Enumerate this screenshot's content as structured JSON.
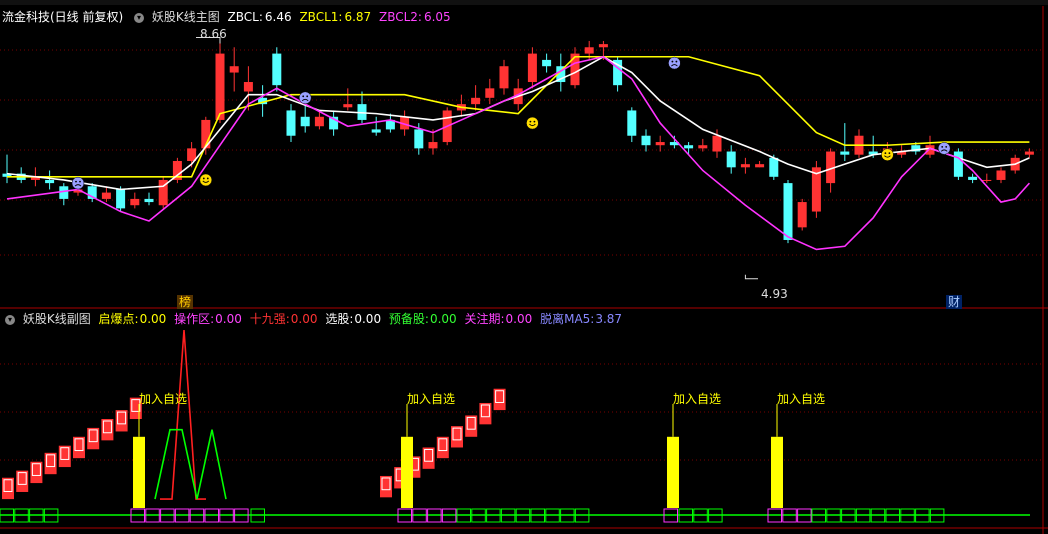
{
  "main_header": {
    "stock": "流金科技(日线 前复权)",
    "indicator": "妖股K线主图",
    "zbcl_label": "ZBCL:",
    "zbcl_value": "6.46",
    "zbcl1_label": "ZBCL1:",
    "zbcl1_value": "6.87",
    "zbcl2_label": "ZBCL2:",
    "zbcl2_value": "6.05",
    "high_label": "8.66",
    "low_label": "4.93",
    "badge_left": "榜",
    "badge_right": "财"
  },
  "sub_header": {
    "indicator": "妖股K线副图",
    "items": [
      {
        "label": "启爆点:",
        "value": "0.00",
        "color": "#ffff00"
      },
      {
        "label": "操作区:",
        "value": "0.00",
        "color": "#ff44ff"
      },
      {
        "label": "十九强:",
        "value": "0.00",
        "color": "#ff3333"
      },
      {
        "label": "选股:",
        "value": "0.00",
        "color": "#ffffff"
      },
      {
        "label": "预备股:",
        "value": "0.00",
        "color": "#33ff33"
      },
      {
        "label": "关注期:",
        "value": "0.00",
        "color": "#ff44ff"
      },
      {
        "label": "脱离MA5:",
        "value": "3.87",
        "color": "#8888ff"
      }
    ],
    "signal_text": "加入自选"
  },
  "colors": {
    "up": "#ff3333",
    "down": "#54ffff",
    "ma_white": "#ffffff",
    "ma_yellow": "#ffff00",
    "ma_magenta": "#ff33ff",
    "grid": "#7a0000",
    "green": "#00ff00",
    "yellow_bar": "#ffff00"
  },
  "chart_data": {
    "type": "candlestick",
    "ylim": [
      4.6,
      9.0
    ],
    "candles": [
      [
        6.6,
        6.55,
        6.9,
        6.45
      ],
      [
        6.6,
        6.5,
        6.7,
        6.45
      ],
      [
        6.5,
        6.55,
        6.7,
        6.4
      ],
      [
        6.5,
        6.45,
        6.65,
        6.35
      ],
      [
        6.4,
        6.2,
        6.45,
        6.1
      ],
      [
        6.3,
        6.35,
        6.45,
        6.25
      ],
      [
        6.4,
        6.2,
        6.45,
        6.15
      ],
      [
        6.2,
        6.3,
        6.4,
        6.15
      ],
      [
        6.35,
        6.05,
        6.4,
        6.0
      ],
      [
        6.1,
        6.2,
        6.3,
        6.05
      ],
      [
        6.2,
        6.15,
        6.3,
        6.1
      ],
      [
        6.1,
        6.5,
        6.55,
        6.05
      ],
      [
        6.5,
        6.8,
        6.85,
        6.45
      ],
      [
        6.8,
        7.0,
        7.1,
        6.7
      ],
      [
        7.0,
        7.45,
        7.5,
        6.9
      ],
      [
        7.45,
        8.5,
        8.66,
        7.4
      ],
      [
        8.2,
        8.3,
        8.6,
        7.9
      ],
      [
        7.9,
        8.05,
        8.3,
        7.6
      ],
      [
        7.8,
        7.7,
        8.0,
        7.5
      ],
      [
        8.5,
        8.0,
        8.6,
        7.9
      ],
      [
        7.6,
        7.2,
        7.7,
        7.1
      ],
      [
        7.5,
        7.35,
        7.7,
        7.25
      ],
      [
        7.35,
        7.5,
        7.6,
        7.3
      ],
      [
        7.5,
        7.3,
        7.6,
        7.2
      ],
      [
        7.65,
        7.7,
        7.95,
        7.6
      ],
      [
        7.7,
        7.45,
        7.9,
        7.4
      ],
      [
        7.3,
        7.25,
        7.5,
        7.2
      ],
      [
        7.45,
        7.3,
        7.55,
        7.25
      ],
      [
        7.3,
        7.5,
        7.6,
        7.2
      ],
      [
        7.3,
        7.0,
        7.4,
        6.9
      ],
      [
        7.0,
        7.1,
        7.3,
        6.9
      ],
      [
        7.1,
        7.6,
        7.65,
        7.05
      ],
      [
        7.6,
        7.7,
        7.85,
        7.5
      ],
      [
        7.7,
        7.8,
        8.0,
        7.6
      ],
      [
        7.8,
        7.95,
        8.1,
        7.7
      ],
      [
        7.95,
        8.3,
        8.4,
        7.85
      ],
      [
        7.7,
        7.95,
        8.1,
        7.6
      ],
      [
        8.05,
        8.5,
        8.6,
        7.95
      ],
      [
        8.4,
        8.3,
        8.5,
        8.2
      ],
      [
        8.3,
        8.05,
        8.5,
        7.9
      ],
      [
        8.0,
        8.5,
        8.6,
        7.95
      ],
      [
        8.5,
        8.6,
        8.7,
        8.4
      ],
      [
        8.6,
        8.65,
        8.7,
        8.4
      ],
      [
        8.4,
        8.0,
        8.45,
        7.9
      ],
      [
        7.6,
        7.2,
        7.65,
        7.1
      ],
      [
        7.2,
        7.05,
        7.3,
        6.95
      ],
      [
        7.05,
        7.1,
        7.2,
        6.95
      ],
      [
        7.1,
        7.05,
        7.2,
        7.0
      ],
      [
        7.05,
        7.0,
        7.1,
        6.9
      ],
      [
        7.0,
        7.05,
        7.15,
        6.95
      ],
      [
        6.95,
        7.2,
        7.3,
        6.85
      ],
      [
        6.95,
        6.7,
        7.05,
        6.6
      ],
      [
        6.7,
        6.75,
        6.85,
        6.6
      ],
      [
        6.7,
        6.75,
        6.8,
        6.7
      ],
      [
        6.85,
        6.55,
        6.9,
        6.5
      ],
      [
        6.45,
        5.55,
        6.5,
        5.5
      ],
      [
        5.75,
        6.15,
        6.2,
        5.7
      ],
      [
        6.0,
        6.7,
        6.8,
        5.9
      ],
      [
        6.45,
        6.95,
        7.0,
        6.3
      ],
      [
        6.95,
        6.9,
        7.4,
        6.8
      ],
      [
        6.9,
        7.2,
        7.3,
        6.85
      ],
      [
        6.95,
        6.9,
        7.2,
        6.85
      ],
      [
        6.9,
        7.0,
        7.1,
        6.85
      ],
      [
        6.9,
        6.95,
        7.05,
        6.85
      ],
      [
        7.05,
        6.95,
        7.1,
        6.9
      ],
      [
        6.9,
        7.05,
        7.2,
        6.85
      ],
      [
        7.0,
        6.95,
        7.05,
        6.9
      ],
      [
        6.95,
        6.55,
        7.0,
        6.5
      ],
      [
        6.55,
        6.5,
        6.6,
        6.45
      ],
      [
        6.5,
        6.5,
        6.6,
        6.45
      ],
      [
        6.5,
        6.65,
        6.7,
        6.45
      ],
      [
        6.65,
        6.85,
        6.9,
        6.6
      ],
      [
        6.9,
        6.95,
        7.0,
        6.85
      ]
    ],
    "ma_white": [
      [
        0,
        6.6
      ],
      [
        4,
        6.5
      ],
      [
        8,
        6.35
      ],
      [
        11,
        6.4
      ],
      [
        13,
        6.75
      ],
      [
        15,
        7.3
      ],
      [
        17,
        7.85
      ],
      [
        19,
        7.85
      ],
      [
        22,
        7.6
      ],
      [
        26,
        7.55
      ],
      [
        30,
        7.45
      ],
      [
        33,
        7.55
      ],
      [
        35,
        7.75
      ],
      [
        37,
        7.9
      ],
      [
        40,
        8.2
      ],
      [
        42,
        8.45
      ],
      [
        44,
        8.2
      ],
      [
        46,
        7.75
      ],
      [
        49,
        7.3
      ],
      [
        53,
        6.95
      ],
      [
        55,
        6.75
      ],
      [
        57,
        6.6
      ],
      [
        59,
        6.75
      ],
      [
        61,
        6.9
      ],
      [
        63,
        6.95
      ],
      [
        65,
        7.0
      ],
      [
        67,
        6.85
      ],
      [
        69,
        6.7
      ],
      [
        71,
        6.75
      ],
      [
        72,
        6.85
      ]
    ],
    "ma_yellow": [
      [
        0,
        6.55
      ],
      [
        13,
        6.55
      ],
      [
        15,
        7.55
      ],
      [
        20,
        7.85
      ],
      [
        28,
        7.85
      ],
      [
        32,
        7.65
      ],
      [
        36,
        7.55
      ],
      [
        40,
        8.45
      ],
      [
        42,
        8.45
      ],
      [
        48,
        8.45
      ],
      [
        53,
        8.15
      ],
      [
        57,
        7.25
      ],
      [
        59,
        7.05
      ],
      [
        62,
        7.05
      ],
      [
        66,
        7.1
      ],
      [
        72,
        7.1
      ]
    ],
    "ma_magenta": [
      [
        0,
        6.2
      ],
      [
        5,
        6.35
      ],
      [
        8,
        6.0
      ],
      [
        10,
        5.85
      ],
      [
        13,
        6.4
      ],
      [
        15,
        7.05
      ],
      [
        17,
        7.7
      ],
      [
        19,
        7.95
      ],
      [
        21,
        7.7
      ],
      [
        24,
        7.35
      ],
      [
        27,
        7.45
      ],
      [
        30,
        7.25
      ],
      [
        32,
        7.45
      ],
      [
        34,
        7.65
      ],
      [
        36,
        7.85
      ],
      [
        38,
        8.1
      ],
      [
        40,
        8.35
      ],
      [
        42,
        8.45
      ],
      [
        44,
        8.1
      ],
      [
        46,
        7.4
      ],
      [
        49,
        6.65
      ],
      [
        52,
        6.1
      ],
      [
        55,
        5.6
      ],
      [
        57,
        5.4
      ],
      [
        59,
        5.45
      ],
      [
        61,
        5.9
      ],
      [
        63,
        6.55
      ],
      [
        65,
        7.0
      ],
      [
        67,
        6.85
      ],
      [
        68,
        6.65
      ],
      [
        70,
        6.15
      ],
      [
        71,
        6.2
      ],
      [
        72,
        6.45
      ]
    ],
    "emoji_points": [
      [
        5,
        6.45,
        "sad"
      ],
      [
        14,
        6.5,
        "happy"
      ],
      [
        21,
        7.8,
        "sad"
      ],
      [
        37,
        7.4,
        "happy"
      ],
      [
        47,
        8.35,
        "sad"
      ],
      [
        62,
        6.9,
        "happy"
      ],
      [
        66,
        7.0,
        "sad"
      ]
    ],
    "sub_ylim": [
      0,
      100
    ],
    "stair_left": [
      [
        0,
        5
      ],
      [
        1,
        9
      ],
      [
        2,
        14
      ],
      [
        3,
        19
      ],
      [
        4,
        23
      ],
      [
        5,
        28
      ],
      [
        6,
        33
      ],
      [
        7,
        38
      ],
      [
        8,
        43
      ],
      [
        9,
        50
      ]
    ],
    "stair_mid": [
      [
        10,
        6
      ],
      [
        11,
        11
      ],
      [
        12,
        17
      ],
      [
        13,
        22
      ],
      [
        14,
        28
      ],
      [
        15,
        34
      ],
      [
        16,
        40
      ],
      [
        17,
        47
      ],
      [
        18,
        55
      ]
    ],
    "yellow_bars": [
      [
        138,
        40
      ],
      [
        406,
        40
      ],
      [
        672,
        40
      ],
      [
        776,
        40
      ]
    ],
    "red_spike": [
      [
        160,
        5
      ],
      [
        172,
        5
      ],
      [
        184,
        100
      ],
      [
        196,
        5
      ],
      [
        206,
        5
      ]
    ],
    "green_spike": [
      [
        155,
        5
      ],
      [
        170,
        44
      ],
      [
        182,
        44
      ],
      [
        197,
        5
      ],
      [
        212,
        44
      ],
      [
        226,
        5
      ]
    ]
  }
}
